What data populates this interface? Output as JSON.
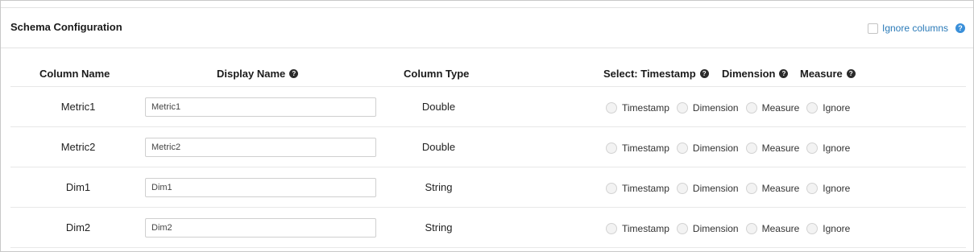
{
  "header": {
    "title": "Schema Configuration",
    "ignore_columns_label": "Ignore columns"
  },
  "table": {
    "headers": {
      "column_name": "Column Name",
      "display_name": "Display Name",
      "column_type": "Column Type",
      "select_timestamp": "Select: Timestamp",
      "dimension": "Dimension",
      "measure": "Measure"
    },
    "radio_options": [
      "Timestamp",
      "Dimension",
      "Measure",
      "Ignore"
    ],
    "rows": [
      {
        "name": "Metric1",
        "display_name": "Metric1",
        "type": "Double"
      },
      {
        "name": "Metric2",
        "display_name": "Metric2",
        "type": "Double"
      },
      {
        "name": "Dim1",
        "display_name": "Dim1",
        "type": "String"
      },
      {
        "name": "Dim2",
        "display_name": "Dim2",
        "type": "String"
      }
    ]
  },
  "colors": {
    "link": "#2a7ab8",
    "help_blue": "#3a8fd9",
    "help_dark": "#2b2b2b",
    "divider": "#e8e8e8"
  },
  "icons": {
    "help_blue": "help-circle-icon",
    "help_dark": "help-circle-icon"
  }
}
